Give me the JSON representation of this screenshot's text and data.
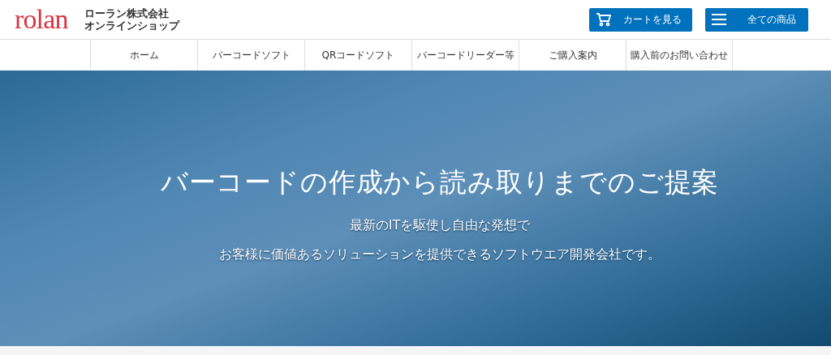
{
  "header": {
    "logo": "rolan",
    "company": "ローラン株式会社",
    "shop": "オンラインショップ",
    "buttons": [
      {
        "kind": "cart",
        "label": "カートを見る"
      },
      {
        "kind": "menu",
        "label": "全ての商品"
      }
    ]
  },
  "nav": {
    "items": [
      {
        "label": "ホーム"
      },
      {
        "label": "バーコードソフト"
      },
      {
        "label": "QRコードソフト"
      },
      {
        "label": "バーコードリーダー等"
      },
      {
        "label": "ご購入案内"
      },
      {
        "label": "購入前のお問い合わせ"
      }
    ]
  },
  "hero": {
    "title": "バーコードの作成から読み取りまでのご提案",
    "lines": [
      "最新のITを駆使し自由な発想で",
      "お客様に価値あるソリューションを提供できるソフトウエア開発会社です。"
    ]
  }
}
